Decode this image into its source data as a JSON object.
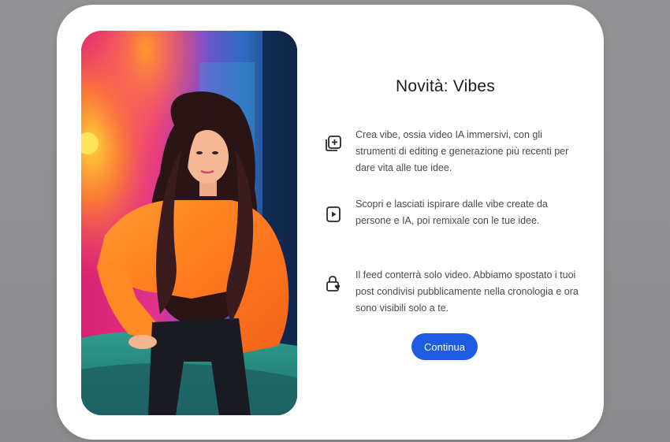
{
  "dialog": {
    "title": "Novità: Vibes",
    "features": [
      {
        "icon": "add-video-icon",
        "text": "Crea vibe, ossia video IA immersivi, con gli strumenti di editing e generazione più recenti per dare vita alle tue idee."
      },
      {
        "icon": "play-video-icon",
        "text": "Scopri e lasciati ispirare dalle vibe create da persone e IA, poi remixale con le tue idee."
      },
      {
        "icon": "lock-heart-icon",
        "text": "Il feed conterrà solo video. Abbiamo spostato i tuoi post condivisi pubblicamente nella cronologia e ora sono visibili solo a te."
      }
    ],
    "continue_label": "Continua"
  },
  "colors": {
    "backdrop": "#8f8f91",
    "modal": "#ffffff",
    "button": "#1d5ce0",
    "title": "#1c1c1c",
    "body_text": "#4a4a4a"
  },
  "hero_image": {
    "description_icon": "illustration-image"
  }
}
